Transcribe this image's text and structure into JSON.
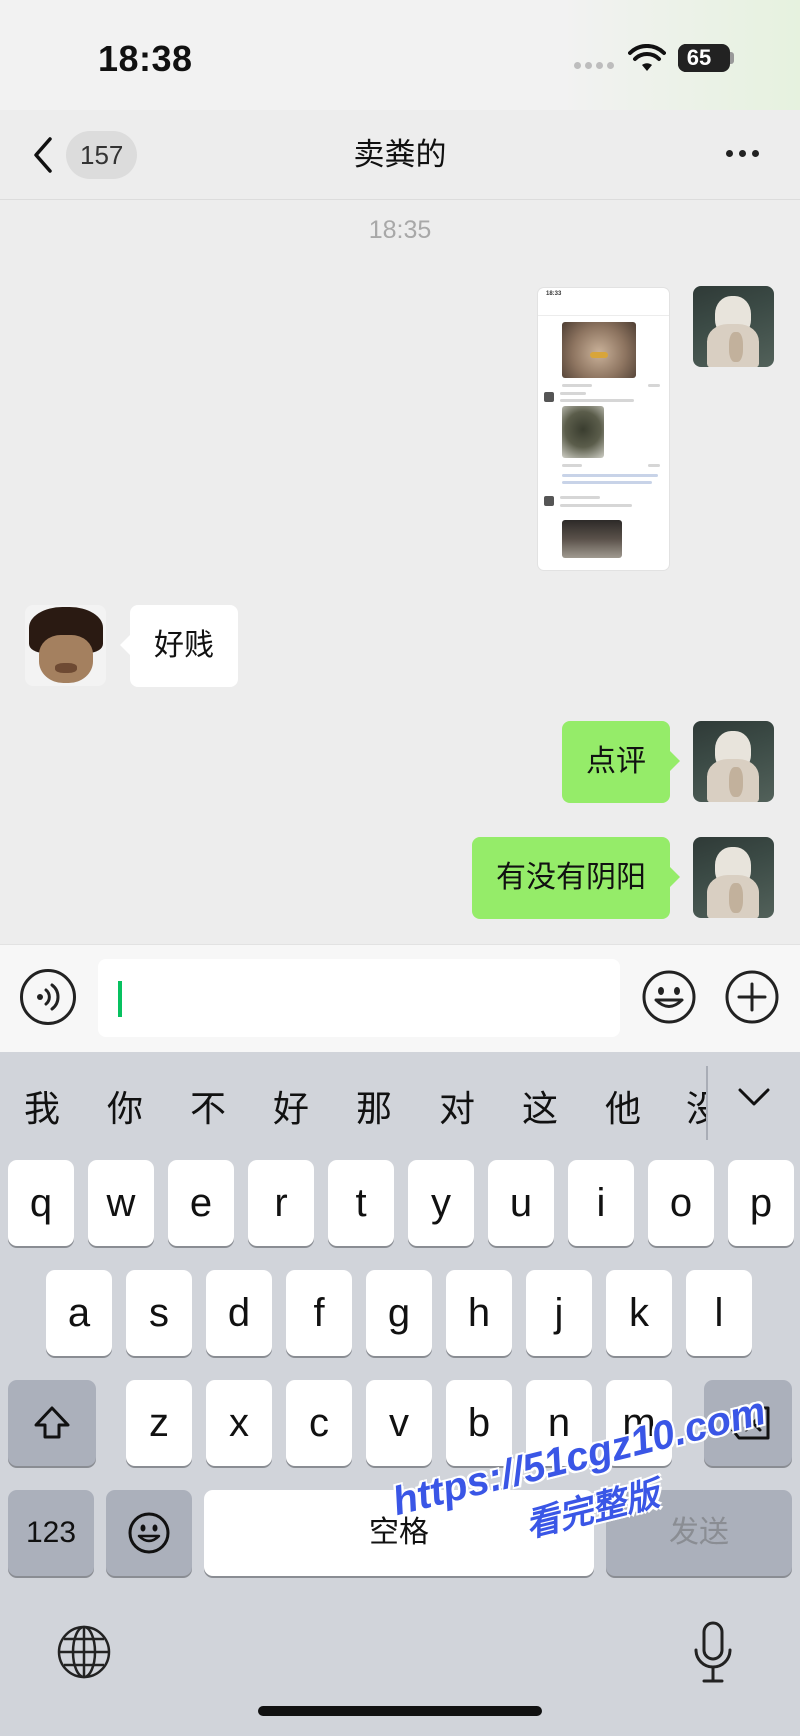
{
  "status_bar": {
    "time": "18:38",
    "battery": "65",
    "battery_level": 0.65
  },
  "nav": {
    "back_icon": "chevron-left-icon",
    "unread_count": "157",
    "title": "卖粪的",
    "more_icon": "more-dots-icon"
  },
  "chat": {
    "timestamp": "18:35",
    "messages": [
      {
        "sender": "self",
        "type": "image"
      },
      {
        "sender": "other",
        "type": "text",
        "text": "好贱"
      },
      {
        "sender": "self",
        "type": "text",
        "text": "点评"
      },
      {
        "sender": "self",
        "type": "text",
        "text": "有没有阴阳"
      }
    ]
  },
  "input_bar": {
    "voice_icon": "voice-icon",
    "value": "",
    "emoji_icon": "emoji-icon",
    "add_icon": "plus-circle-icon"
  },
  "keyboard": {
    "candidates": [
      "我",
      "你",
      "不",
      "好",
      "那",
      "对",
      "这",
      "他"
    ],
    "candidate_partial": "没",
    "collapse_icon": "chevron-down-icon",
    "row1": [
      "q",
      "w",
      "e",
      "r",
      "t",
      "y",
      "u",
      "i",
      "o",
      "p"
    ],
    "row2": [
      "a",
      "s",
      "d",
      "f",
      "g",
      "h",
      "j",
      "k",
      "l"
    ],
    "row3": [
      "z",
      "x",
      "c",
      "v",
      "b",
      "n",
      "m"
    ],
    "shift_icon": "shift-icon",
    "delete_icon": "backspace-icon",
    "num_key": "123",
    "emoji_key_icon": "emoji-icon",
    "space": "空格",
    "send": "发送",
    "globe_icon": "globe-icon",
    "mic_icon": "microphone-icon"
  },
  "watermark": {
    "url": "https://51cgz10.com",
    "text": "看完整版"
  },
  "colors": {
    "accent_green": "#07c160",
    "outgoing_bubble": "#95ec69",
    "incoming_bubble": "#ffffff",
    "background": "#ededed",
    "keyboard_bg": "#d1d4da",
    "watermark": "#3a56e6"
  }
}
